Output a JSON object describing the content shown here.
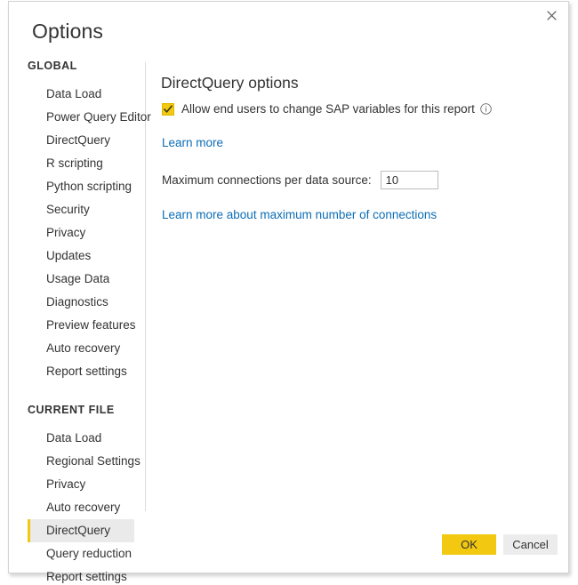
{
  "window": {
    "title": "Options",
    "close_icon": "close-icon",
    "close_label": "Close"
  },
  "sidebar": {
    "groups": [
      {
        "header": "GLOBAL",
        "items": [
          {
            "label": "Data Load",
            "selected": false
          },
          {
            "label": "Power Query Editor",
            "selected": false
          },
          {
            "label": "DirectQuery",
            "selected": false
          },
          {
            "label": "R scripting",
            "selected": false
          },
          {
            "label": "Python scripting",
            "selected": false
          },
          {
            "label": "Security",
            "selected": false
          },
          {
            "label": "Privacy",
            "selected": false
          },
          {
            "label": "Updates",
            "selected": false
          },
          {
            "label": "Usage Data",
            "selected": false
          },
          {
            "label": "Diagnostics",
            "selected": false
          },
          {
            "label": "Preview features",
            "selected": false
          },
          {
            "label": "Auto recovery",
            "selected": false
          },
          {
            "label": "Report settings",
            "selected": false
          }
        ]
      },
      {
        "header": "CURRENT FILE",
        "items": [
          {
            "label": "Data Load",
            "selected": false
          },
          {
            "label": "Regional Settings",
            "selected": false
          },
          {
            "label": "Privacy",
            "selected": false
          },
          {
            "label": "Auto recovery",
            "selected": false
          },
          {
            "label": "DirectQuery",
            "selected": true
          },
          {
            "label": "Query reduction",
            "selected": false
          },
          {
            "label": "Report settings",
            "selected": false
          }
        ]
      }
    ]
  },
  "main": {
    "title": "DirectQuery options",
    "checkbox": {
      "label": "Allow end users to change SAP variables for this report",
      "checked": true,
      "check_icon": "check-icon",
      "info_icon": "info-icon"
    },
    "learn_more_link": "Learn more",
    "connections": {
      "label": "Maximum connections per data source:",
      "value": "10",
      "placeholder": ""
    },
    "connections_link": "Learn more about maximum number of connections"
  },
  "footer": {
    "ok_label": "OK",
    "cancel_label": "Cancel"
  },
  "colors": {
    "accent": "#f2c811",
    "link": "#0b6db5",
    "selected_bg": "#eaeaea",
    "cancel_bg": "#ececec",
    "text": "#333333",
    "border": "#d3d3d3"
  }
}
